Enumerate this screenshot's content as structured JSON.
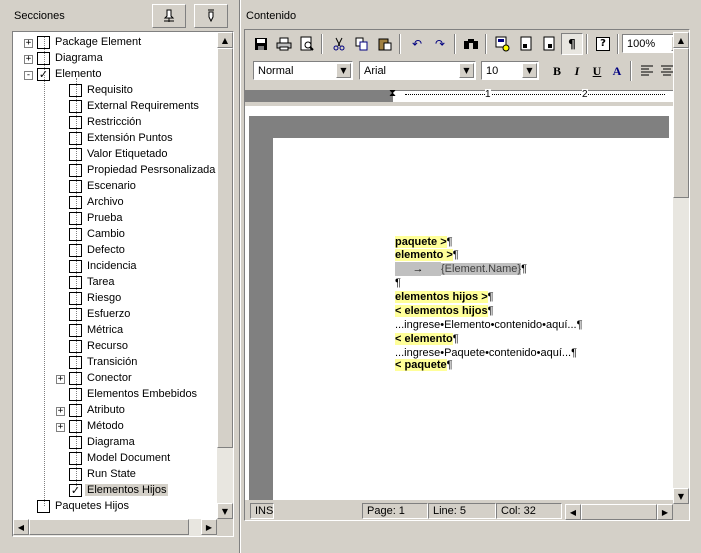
{
  "left_panel": {
    "title": "Secciones",
    "tree": [
      {
        "label": "Package Element",
        "checked": false,
        "expander": "+",
        "level": 0
      },
      {
        "label": "Diagrama",
        "checked": false,
        "expander": "+",
        "level": 0
      },
      {
        "label": "Elemento",
        "checked": true,
        "expander": "-",
        "level": 0
      },
      {
        "label": "Requisito",
        "checked": false,
        "expander": "",
        "level": 1
      },
      {
        "label": "External Requirements",
        "checked": false,
        "expander": "",
        "level": 1
      },
      {
        "label": "Restricción",
        "checked": false,
        "expander": "",
        "level": 1
      },
      {
        "label": "Extensión Puntos",
        "checked": false,
        "expander": "",
        "level": 1
      },
      {
        "label": "Valor Etiquetado",
        "checked": false,
        "expander": "",
        "level": 1
      },
      {
        "label": "Propiedad Pesrsonalizada",
        "checked": false,
        "expander": "",
        "level": 1
      },
      {
        "label": "Escenario",
        "checked": false,
        "expander": "",
        "level": 1
      },
      {
        "label": "Archivo",
        "checked": false,
        "expander": "",
        "level": 1
      },
      {
        "label": "Prueba",
        "checked": false,
        "expander": "",
        "level": 1
      },
      {
        "label": "Cambio",
        "checked": false,
        "expander": "",
        "level": 1
      },
      {
        "label": "Defecto",
        "checked": false,
        "expander": "",
        "level": 1
      },
      {
        "label": "Incidencia",
        "checked": false,
        "expander": "",
        "level": 1
      },
      {
        "label": "Tarea",
        "checked": false,
        "expander": "",
        "level": 1
      },
      {
        "label": "Riesgo",
        "checked": false,
        "expander": "",
        "level": 1
      },
      {
        "label": "Esfuerzo",
        "checked": false,
        "expander": "",
        "level": 1
      },
      {
        "label": "Métrica",
        "checked": false,
        "expander": "",
        "level": 1
      },
      {
        "label": "Recurso",
        "checked": false,
        "expander": "",
        "level": 1
      },
      {
        "label": "Transición",
        "checked": false,
        "expander": "",
        "level": 1
      },
      {
        "label": "Conector",
        "checked": false,
        "expander": "+",
        "level": 1
      },
      {
        "label": "Elementos Embebidos",
        "checked": false,
        "expander": "",
        "level": 1
      },
      {
        "label": "Atributo",
        "checked": false,
        "expander": "+",
        "level": 1
      },
      {
        "label": "Método",
        "checked": false,
        "expander": "+",
        "level": 1
      },
      {
        "label": "Diagrama",
        "checked": false,
        "expander": "",
        "level": 1
      },
      {
        "label": "Model Document",
        "checked": false,
        "expander": "",
        "level": 1
      },
      {
        "label": "Run State",
        "checked": false,
        "expander": "",
        "level": 1
      },
      {
        "label": "Elementos Hijos",
        "checked": true,
        "expander": "",
        "level": 1,
        "selected": true
      },
      {
        "label": "Paquetes Hijos",
        "checked": false,
        "expander": "",
        "level": 0
      }
    ]
  },
  "right_panel": {
    "title": "Contenido",
    "zoom": "100%",
    "style": "Normal",
    "font": "Arial",
    "size": "10",
    "ruler": {
      "marks": [
        "1",
        "2"
      ]
    }
  },
  "document": {
    "lines": [
      {
        "text": "paquete >",
        "pilcrow": "¶",
        "style": "hl"
      },
      {
        "text": "elemento >",
        "pilcrow": "¶",
        "style": "hl"
      },
      {
        "text": "{Element.Name}",
        "pilcrow": "¶",
        "style": "field",
        "tab": "→"
      },
      {
        "text": "",
        "pilcrow": "¶",
        "style": "plain"
      },
      {
        "text": "elementos hijos >",
        "pilcrow": "¶",
        "style": "hl"
      },
      {
        "text": "< elementos hijos",
        "pilcrow": "¶",
        "style": "hl"
      },
      {
        "text": "...ingrese•Elemento•contenido•aquí...",
        "pilcrow": "¶",
        "style": "plain"
      },
      {
        "text": "< elemento",
        "pilcrow": "¶",
        "style": "hl"
      },
      {
        "text": "...ingrese•Paquete•contenido•aquí...",
        "pilcrow": "¶",
        "style": "plain"
      },
      {
        "text": "< paquete",
        "pilcrow": "¶",
        "style": "hl"
      }
    ]
  },
  "status": {
    "mode": "INS",
    "page": "Page: 1",
    "line": "Line: 5",
    "col": "Col: 32"
  },
  "icons": {
    "header_buttons": [
      "pen-up-icon",
      "pen-down-icon"
    ],
    "toolbar": [
      "save-icon",
      "print-icon",
      "print-preview-icon",
      "cut-icon",
      "copy-icon",
      "paste-icon",
      "undo-icon",
      "redo-icon",
      "find-icon",
      "insert-field-icon",
      "page-icon",
      "page-break-icon",
      "paragraph-marks-icon",
      "help-icon"
    ]
  },
  "format_buttons": {
    "bold": "B",
    "italic": "I",
    "underline": "U",
    "font_color": "A"
  }
}
